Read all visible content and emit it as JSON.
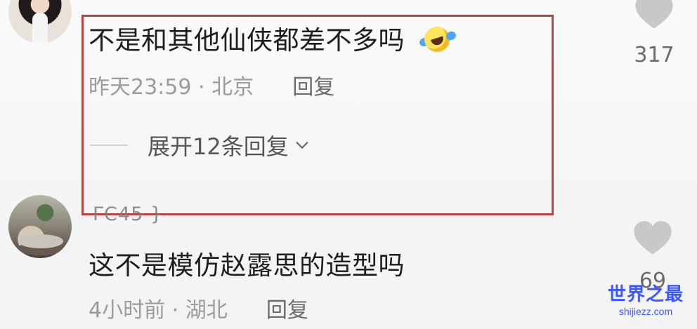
{
  "comments": [
    {
      "text": "不是和其他仙侠都差不多吗",
      "emoji": "laughing-crying-emoji",
      "time": "昨天23:59",
      "separator": "·",
      "location": "北京",
      "reply_label": "回复",
      "expand_label": "展开12条回复",
      "like_count": "317"
    },
    {
      "username_partial": "ΓC45 }",
      "text": "这不是模仿赵露思的造型吗",
      "time": "4小时前",
      "separator": "·",
      "location": "湖北",
      "reply_label": "回复",
      "like_count": "69"
    }
  ],
  "icons": {
    "like": "heart-icon",
    "expand": "chevron-down-icon"
  },
  "colors": {
    "highlight": "#bb4545",
    "watermark": "#3b57ff"
  },
  "watermark": {
    "title": "世界之最",
    "url": "shijiezz.com"
  }
}
